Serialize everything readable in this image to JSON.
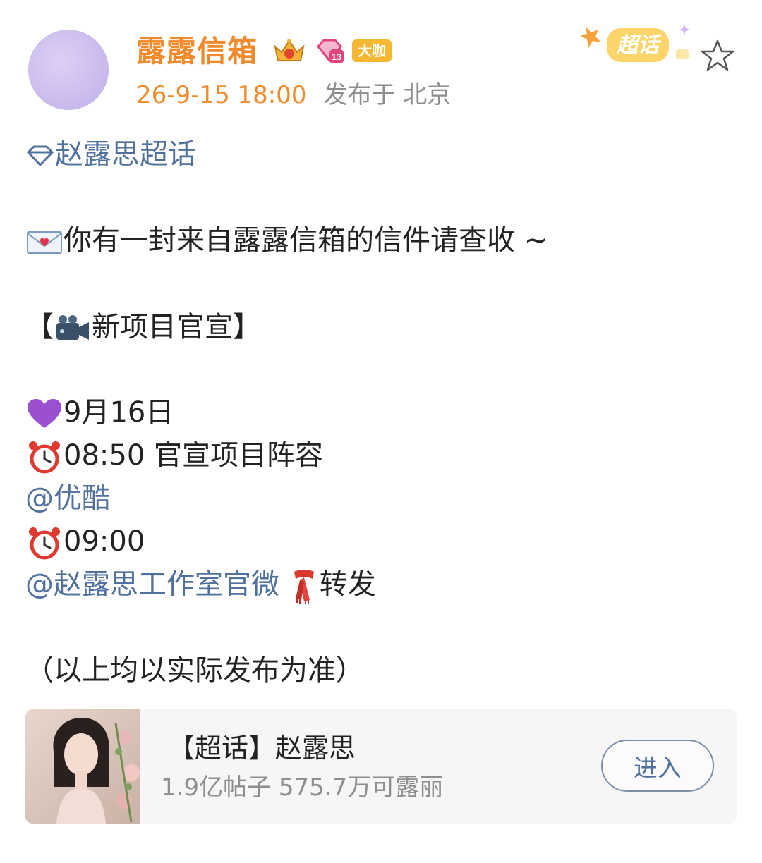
{
  "header": {
    "username": "露露信箱",
    "level_tag": "大咖",
    "time": "26-9-15 18:00",
    "location": "发布于 北京",
    "supertopic_badge_label": "超话"
  },
  "post": {
    "topic_link": "赵露思超话",
    "intro": "你有一封来自露露信箱的信件请查收 ~",
    "section_open": "【",
    "section_title": "新项目官宣",
    "section_close": "】",
    "date": "9月16日",
    "time1_text": "08:50 官宣项目阵容",
    "mention1": "@优酷",
    "time2_text": "09:00",
    "mention2": "@赵露思工作室官微",
    "repost": "转发",
    "note": "（以上均以实际发布为准）"
  },
  "card": {
    "title": "【超话】赵露思",
    "stats": "1.9亿帖子 575.7万可露丽",
    "enter_label": "进入"
  },
  "colors": {
    "username": "#f08a2a",
    "link": "#50709e",
    "meta_gray": "#8e8e8e"
  },
  "icons": [
    "crown-icon",
    "diamond-level-icon",
    "supertopic-icon",
    "star-icon",
    "diamond-icon",
    "love-letter-icon",
    "video-camera-icon",
    "purple-heart-icon",
    "alarm-clock-icon",
    "scarf-icon"
  ]
}
